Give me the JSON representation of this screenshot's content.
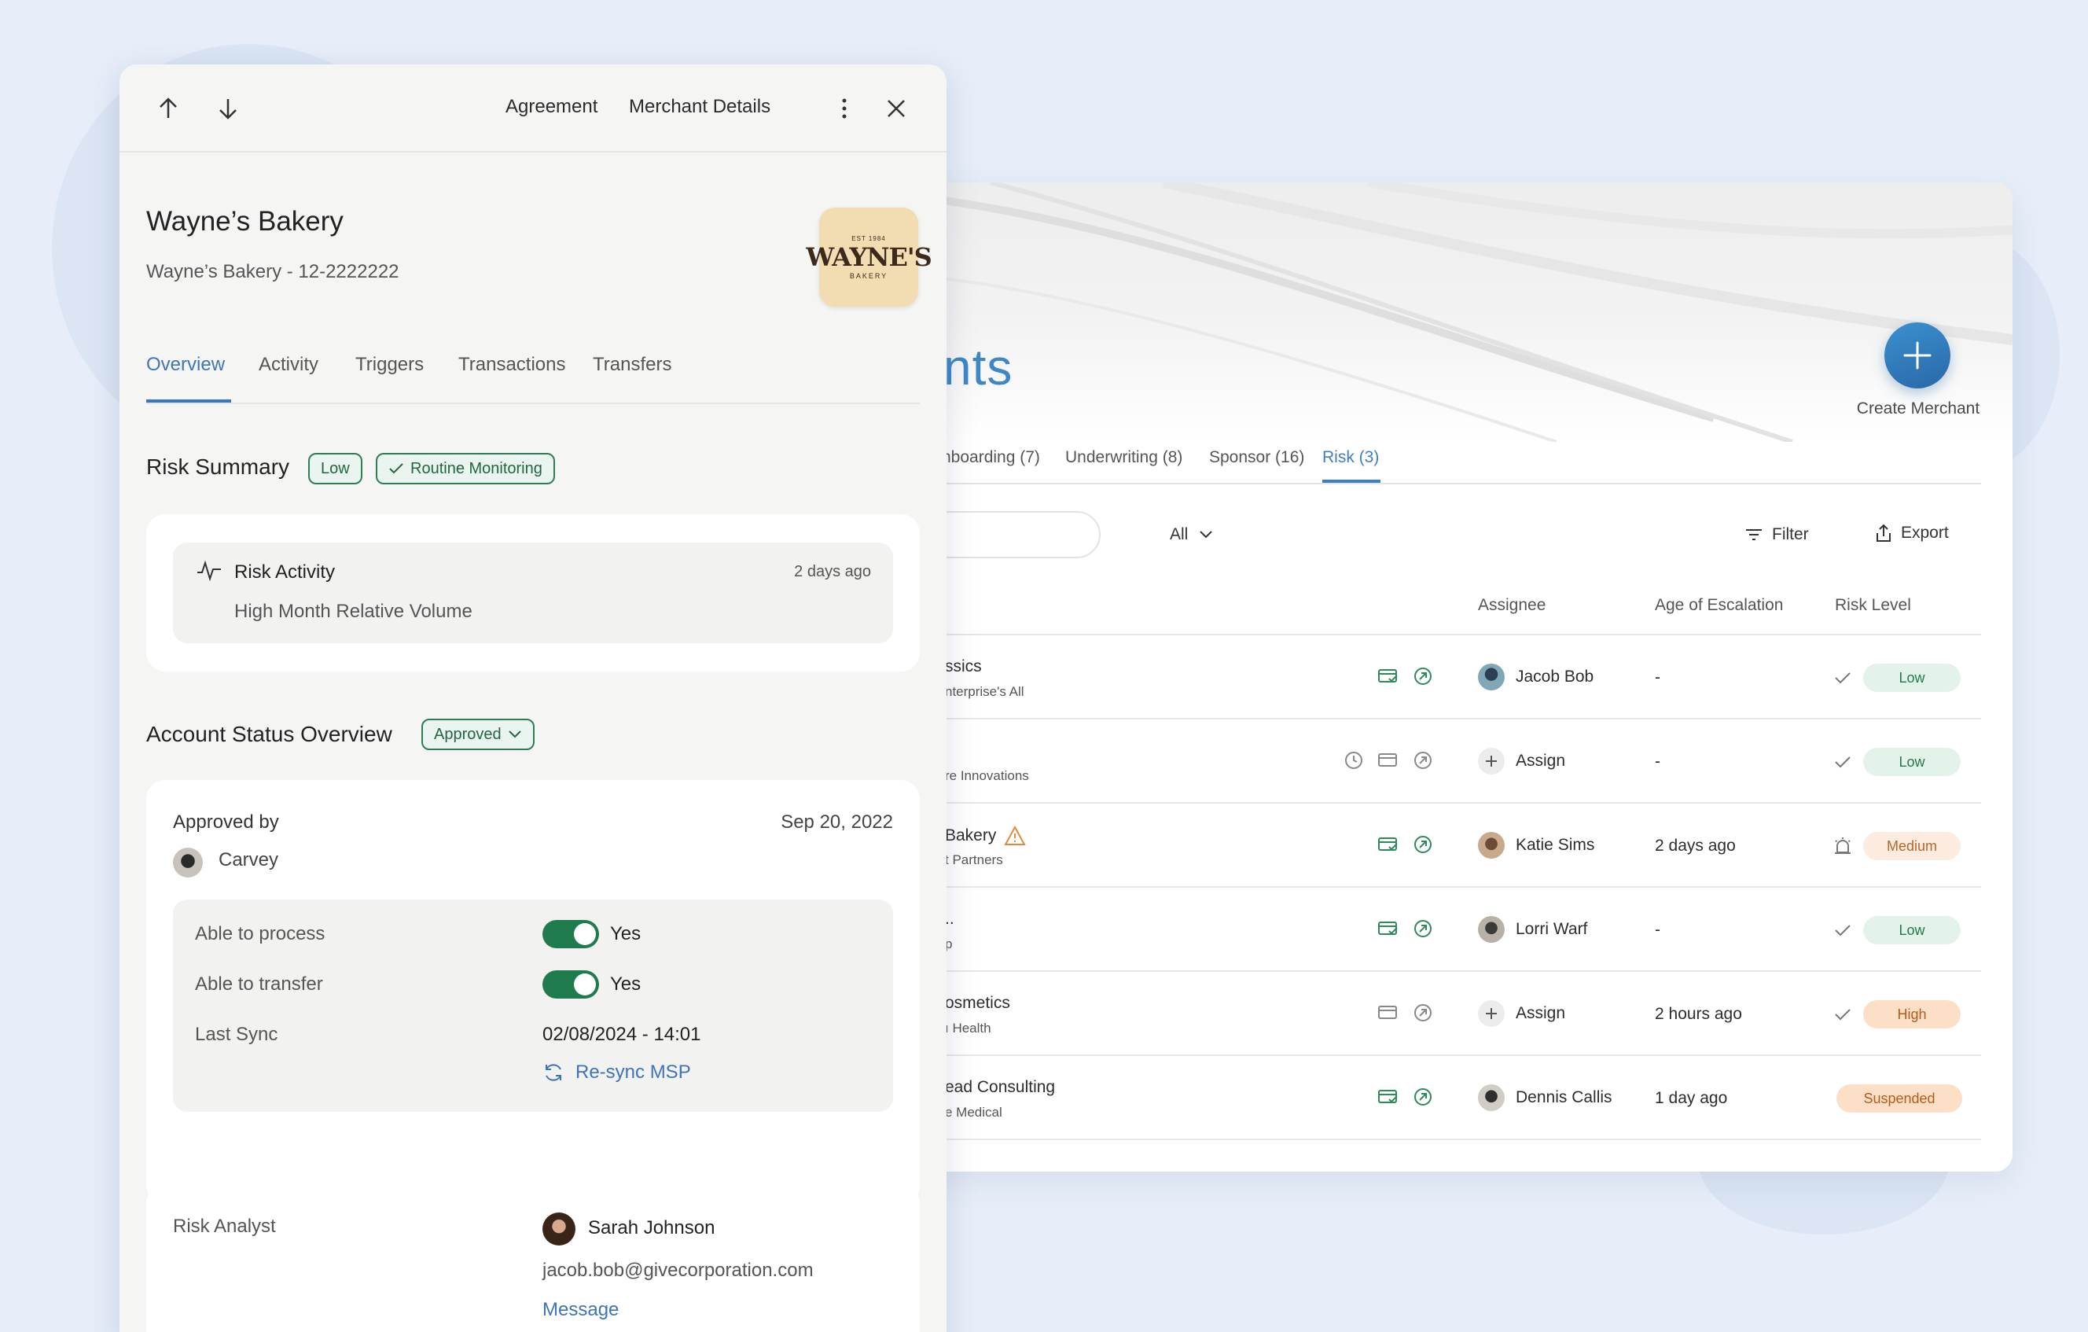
{
  "drawer": {
    "toolbar": {
      "agreement": "Agreement",
      "merchant_details": "Merchant Details"
    },
    "merchant": {
      "name": "Wayne’s Bakery",
      "subtitle": "Wayne’s Bakery - 12-2222222",
      "logo": {
        "est": "EST 1984",
        "wordmark": "WAYNE'S",
        "sub": "BAKERY"
      }
    },
    "tabs": [
      "Overview",
      "Activity",
      "Triggers",
      "Transactions",
      "Transfers"
    ],
    "risk_summary": {
      "title": "Risk Summary",
      "level_tag": "Low",
      "monitoring_tag": "Routine Monitoring",
      "activity": {
        "title": "Risk Activity",
        "time": "2 days ago",
        "detail": "High Month Relative Volume"
      }
    },
    "account_status": {
      "title": "Account Status Overview",
      "status": "Approved",
      "approved_by_label": "Approved by",
      "approved_date": "Sep 20, 2022",
      "approver": "Carvey",
      "fields": [
        {
          "label": "Able to process",
          "value": "Yes"
        },
        {
          "label": "Able to transfer",
          "value": "Yes"
        },
        {
          "label": "Last Sync",
          "value": "02/08/2024 - 14:01"
        }
      ],
      "resync": "Re-sync MSP"
    },
    "risk_analyst": {
      "label": "Risk Analyst",
      "name": "Sarah Johnson",
      "email": "jacob.bob@givecorporation.com",
      "message": "Message"
    }
  },
  "merchants_page": {
    "title_fragment": "nts",
    "create_label": "Create Merchant",
    "tabs": [
      "nboarding (7)",
      "Underwriting (8)",
      "Sponsor (16)",
      "Risk (3)"
    ],
    "filter_all": "All",
    "filter": "Filter",
    "export": "Export",
    "columns": [
      "Assignee",
      "Age of Escalation",
      "Risk Level"
    ],
    "rows": [
      {
        "name": "ssics",
        "sub": "nterprise's All",
        "assignee": "Jacob Bob",
        "age": "-",
        "risk": "Low"
      },
      {
        "name": "",
        "sub": "re Innovations",
        "assignee": "Assign",
        "age": "-",
        "risk": "Low"
      },
      {
        "name": "Bakery",
        "sub": "t Partners",
        "assignee": "Katie Sims",
        "age": "2 days ago",
        "risk": "Medium"
      },
      {
        "name": "..",
        "sub": "p",
        "assignee": "Lorri Warf",
        "age": "-",
        "risk": "Low"
      },
      {
        "name": "osmetics",
        "sub": "ı Health",
        "assignee": "Assign",
        "age": "2 hours ago",
        "risk": "High"
      },
      {
        "name": "ead Consulting",
        "sub": "e Medical",
        "assignee": "Dennis Callis",
        "age": "1 day ago",
        "risk": "Suspended"
      }
    ]
  }
}
